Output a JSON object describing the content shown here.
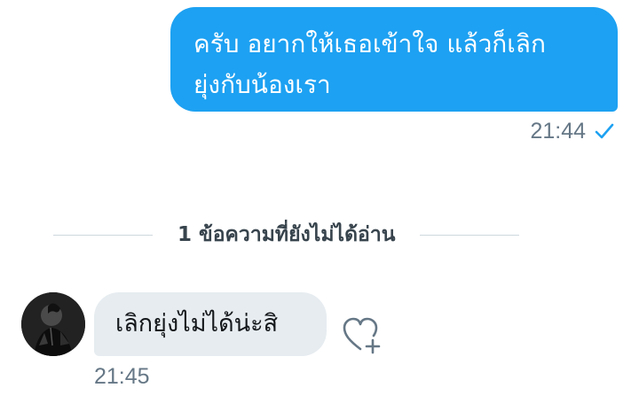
{
  "conversation": {
    "outgoing_message": {
      "text_line1": "ครับ อยากให้เธอเข้าใจ แล้วก็เลิก",
      "text_line2": "ยุ่งกับน้องเรา",
      "time": "21:44",
      "status_icon": "check-icon",
      "bubble_color": "#1da1f2"
    },
    "unread_divider": {
      "label": "1 ข้อความที่ยังไม่ได้อ่าน"
    },
    "incoming_message": {
      "text": "เลิกยุ่งไม่ได้น่ะสิ",
      "time": "21:45",
      "bubble_color": "#e6ecf0",
      "avatar_icon": "avatar",
      "reaction_icon": "heart-plus-icon"
    }
  }
}
